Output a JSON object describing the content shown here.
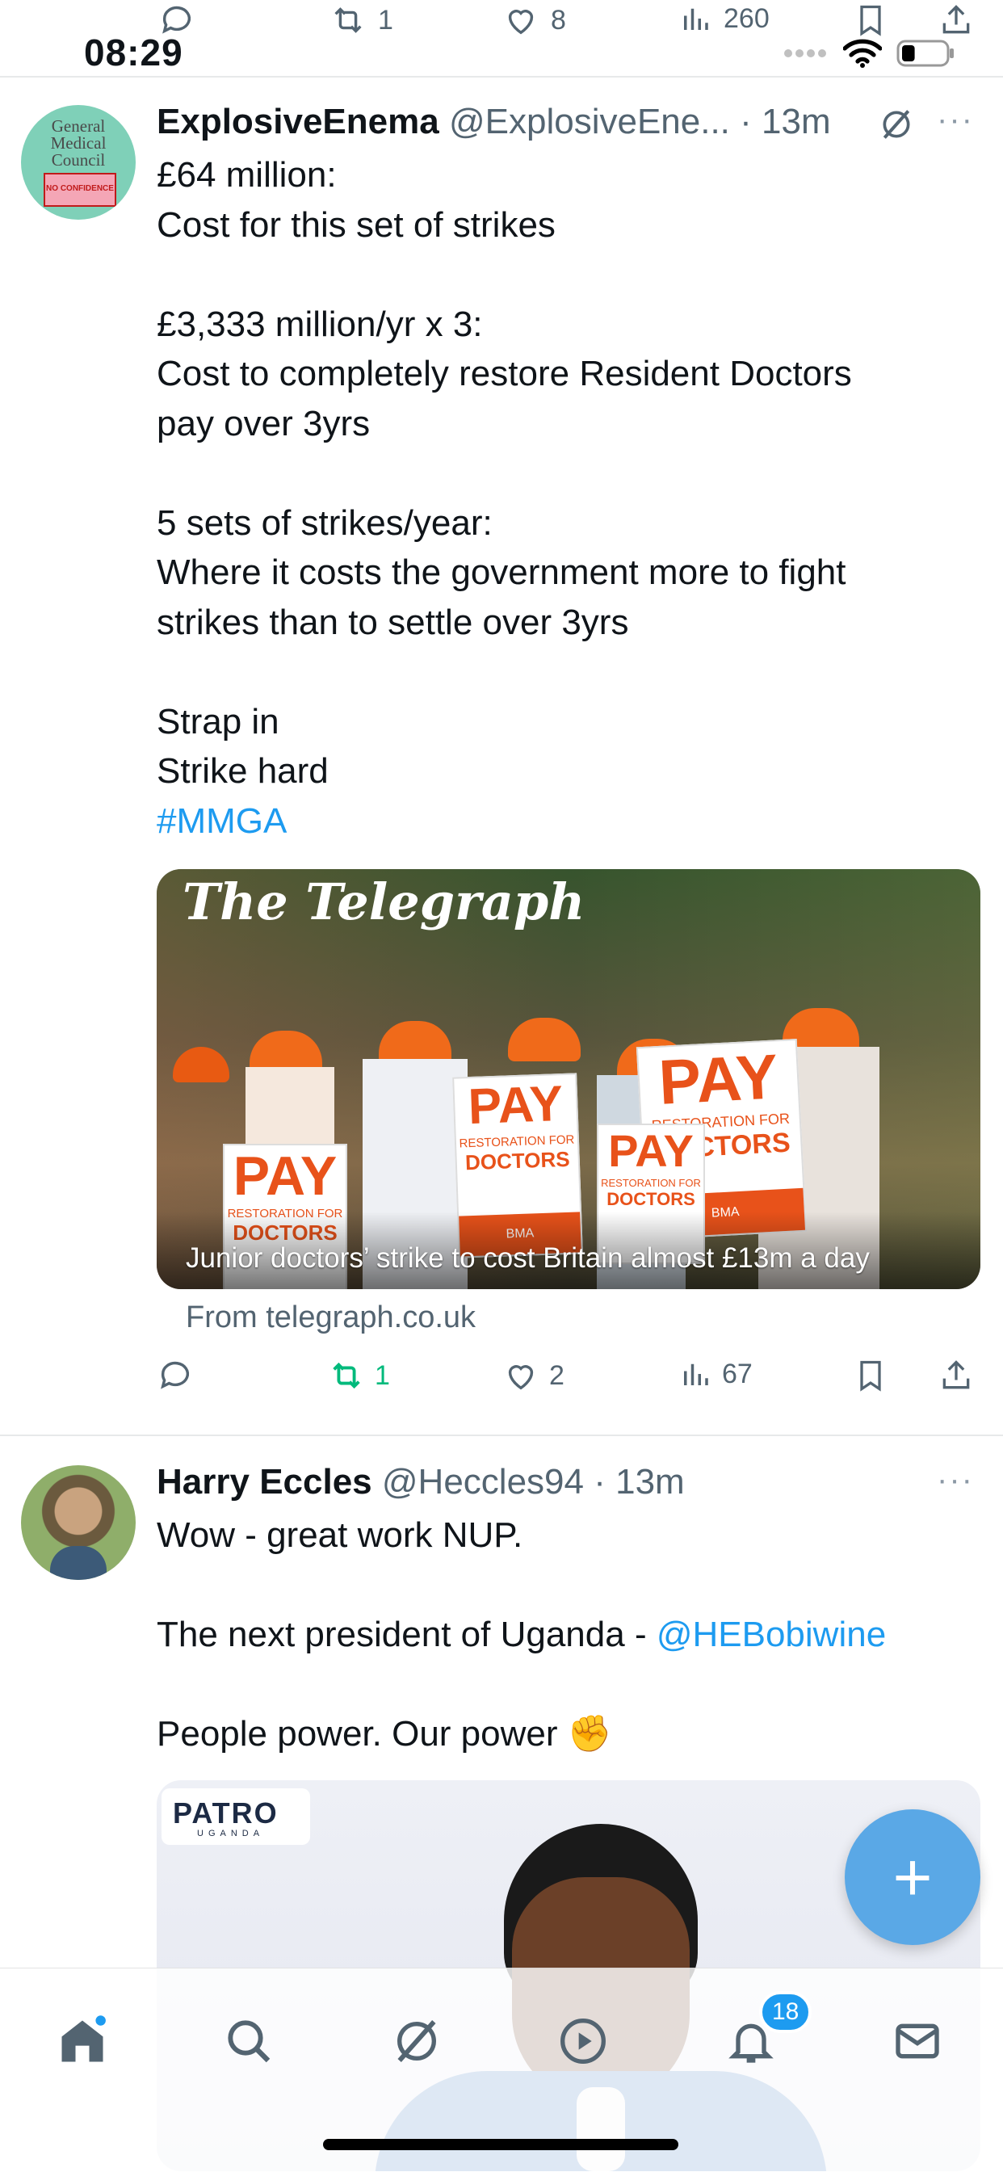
{
  "status_bar": {
    "time": "08:29",
    "battery_level": 0.3
  },
  "prev_tweet_actions": {
    "retweets": "1",
    "likes": "8",
    "views": "260"
  },
  "tweets": [
    {
      "name": "ExplosiveEnema",
      "handle": "@ExplosiveEne...",
      "time": "· 13m",
      "avatar_text": [
        "General",
        "Medical",
        "Council",
        "NO CONFIDENCE"
      ],
      "lines": [
        "£64 million:",
        "Cost for this set of strikes",
        "",
        "£3,333 million/yr x 3:",
        "Cost to completely restore Resident Doctors",
        "pay over 3yrs",
        "",
        "5 sets of strikes/year:",
        "Where it costs the government more to fight",
        "strikes than to settle over 3yrs",
        "",
        "Strap in",
        "Strike hard"
      ],
      "hashtag": "#MMGA",
      "card": {
        "logo": "The Telegraph",
        "caption": "Junior doctors’ strike to cost Britain almost £13m a day",
        "source": "From telegraph.co.uk",
        "sign_main": "PAY",
        "sign_sub": "RESTORATION FOR",
        "sign_doctors": "DOCTORS",
        "sign_bma": "BMA"
      },
      "actions": {
        "replies": "",
        "retweets": "1",
        "likes": "2",
        "views": "67"
      }
    },
    {
      "name": "Harry Eccles",
      "handle": "@Heccles94",
      "time": "· 13m",
      "line1": "Wow - great work NUP.",
      "line2_prefix": "The next president of Uganda - ",
      "mention": "@HEBobiwine",
      "line3": "People power. Our power",
      "emoji": "✊",
      "image_logo": "PATRO",
      "image_logo_sub": "UGANDA"
    }
  ],
  "fab_label": "+",
  "tabs": [
    "home",
    "search",
    "grok",
    "video",
    "notifications",
    "messages"
  ],
  "notifications_badge": "18",
  "colors": {
    "accent": "#1d9bf0",
    "retweet_green": "#00ba7c",
    "muted": "#536471"
  }
}
